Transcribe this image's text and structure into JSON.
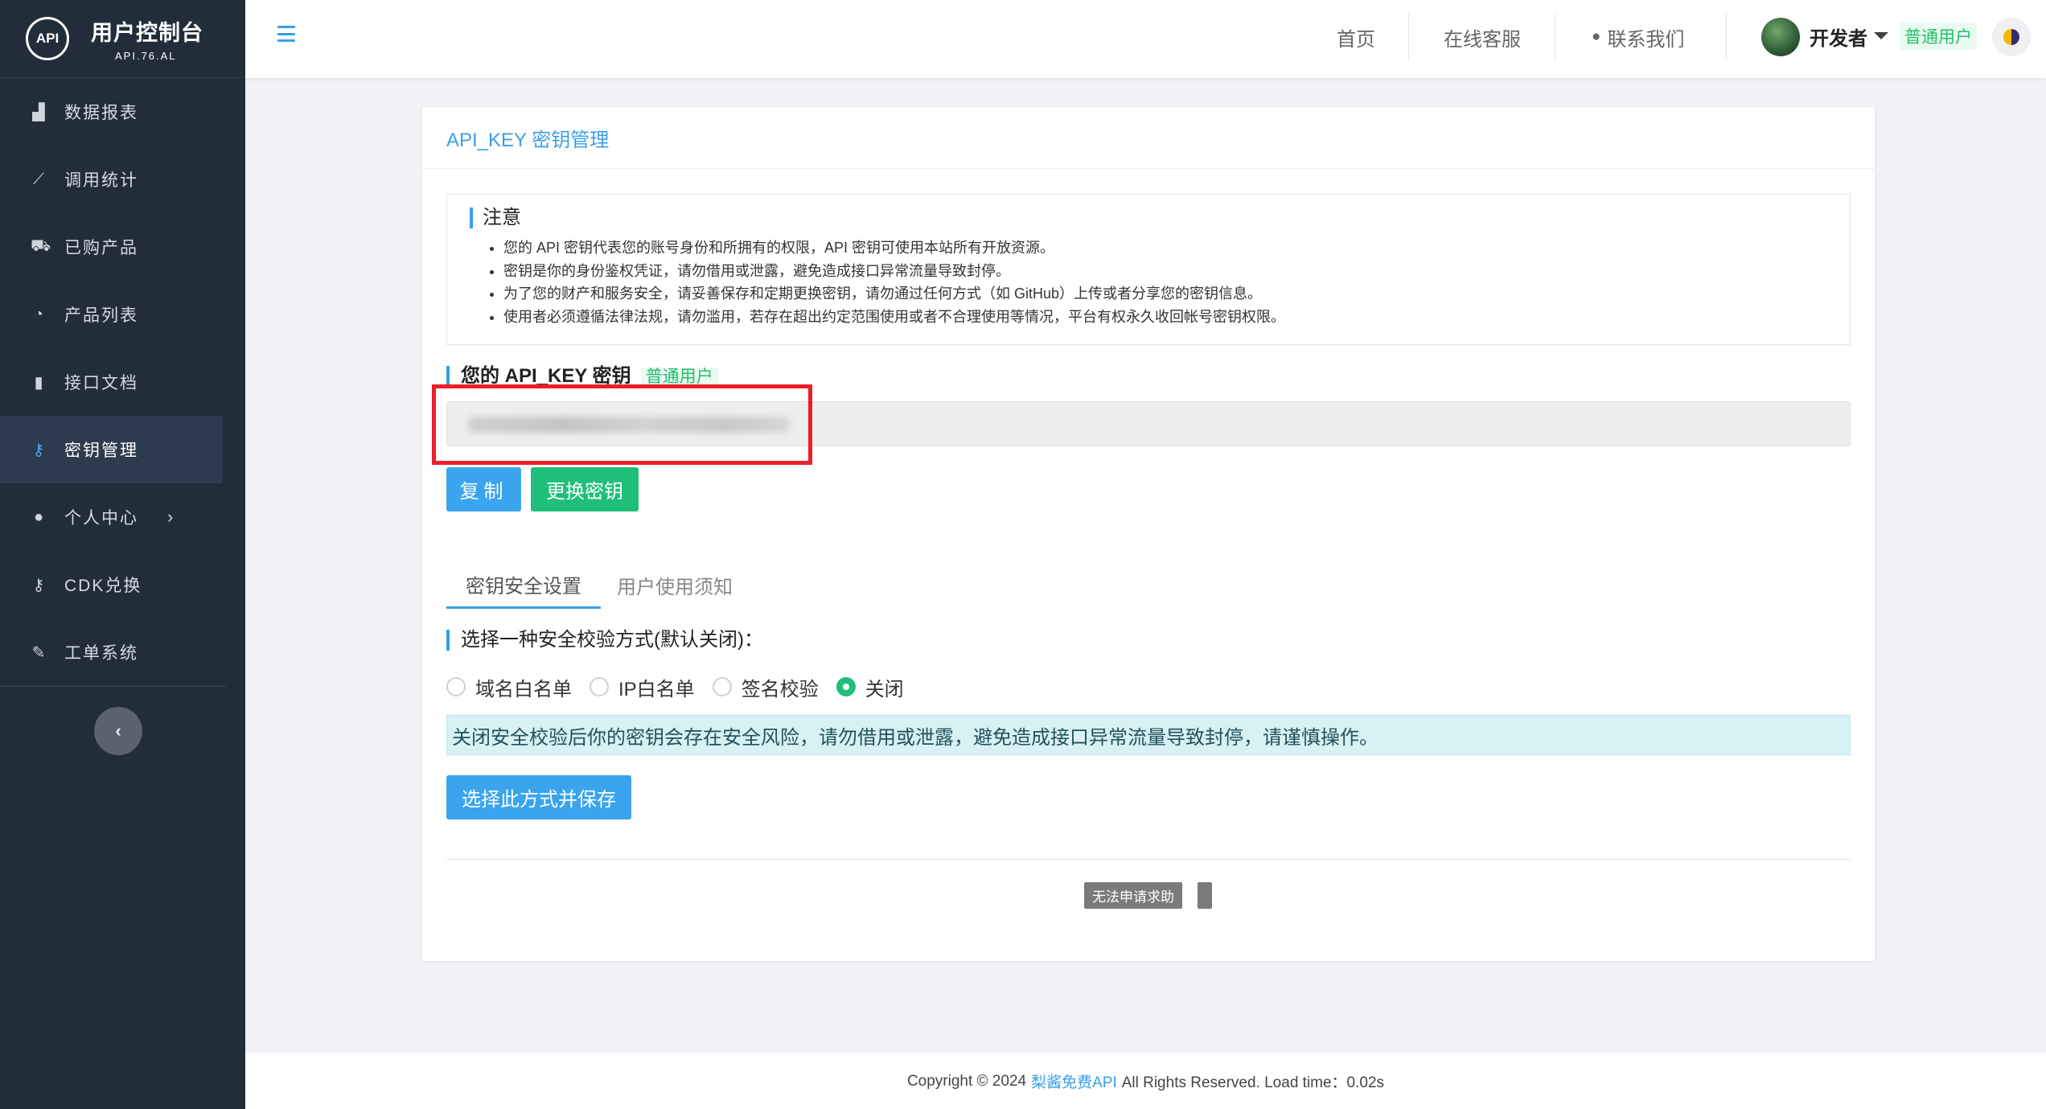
{
  "brand": {
    "logo_text": "API",
    "title": "用户控制台",
    "subtitle": "API.76.AL"
  },
  "sidebar": {
    "items": [
      {
        "label": "数据报表",
        "icon": "chart-area-icon"
      },
      {
        "label": "调用统计",
        "icon": "line-chart-icon"
      },
      {
        "label": "已购产品",
        "icon": "cart-icon"
      },
      {
        "label": "产品列表",
        "icon": "tachometer-icon"
      },
      {
        "label": "接口文档",
        "icon": "book-icon"
      },
      {
        "label": "密钥管理",
        "icon": "key-icon",
        "active": true
      },
      {
        "label": "个人中心",
        "icon": "user-icon",
        "has_submenu": true
      },
      {
        "label": "CDK兑换",
        "icon": "key-icon"
      },
      {
        "label": "工单系统",
        "icon": "pencil-icon"
      }
    ],
    "collapse_symbol": "‹"
  },
  "topbar": {
    "links": [
      "首页",
      "在线客服",
      "联系我们"
    ],
    "user_name": "开发者",
    "user_role": "普通用户"
  },
  "card": {
    "title": "API_KEY 密钥管理",
    "notice": {
      "title": "注意",
      "items": [
        "您的 API 密钥代表您的账号身份和所拥有的权限，API 密钥可使用本站所有开放资源。",
        "密钥是你的身份鉴权凭证，请勿借用或泄露，避免造成接口异常流量导致封停。",
        "为了您的财产和服务安全，请妥善保存和定期更换密钥，请勿通过任何方式（如 GitHub）上传或者分享您的密钥信息。",
        "使用者必须遵循法律法规，请勿滥用，若存在超出约定范围使用或者不合理使用等情况，平台有权永久收回帐号密钥权限。"
      ]
    },
    "key_section": {
      "title": "您的 API_KEY 密钥",
      "tag": "普通用户"
    },
    "buttons": {
      "copy": "复制",
      "change": "更换密钥",
      "save": "选择此方式并保存"
    },
    "tabs": [
      "密钥安全设置",
      "用户使用须知"
    ],
    "security": {
      "title": "选择一种安全校验方式(默认关闭)：",
      "options": [
        "域名白名单",
        "IP白名单",
        "签名校验",
        "关闭"
      ],
      "selected": "关闭",
      "alert": "关闭安全校验后你的密钥会存在安全风险，请勿借用或泄露，避免造成接口异常流量导致封停，请谨慎操作。"
    },
    "help_tag": "无法申请求助"
  },
  "footer": {
    "prefix": "Copyright © 2024",
    "site_link": "梨酱免费API",
    "suffix": "All Rights Reserved. Load time：0.02s"
  },
  "colors": {
    "accent": "#3a9ee8",
    "success": "#1fbf7a",
    "sidebar_bg": "#222d3b",
    "highlight_border": "#e8202a"
  }
}
